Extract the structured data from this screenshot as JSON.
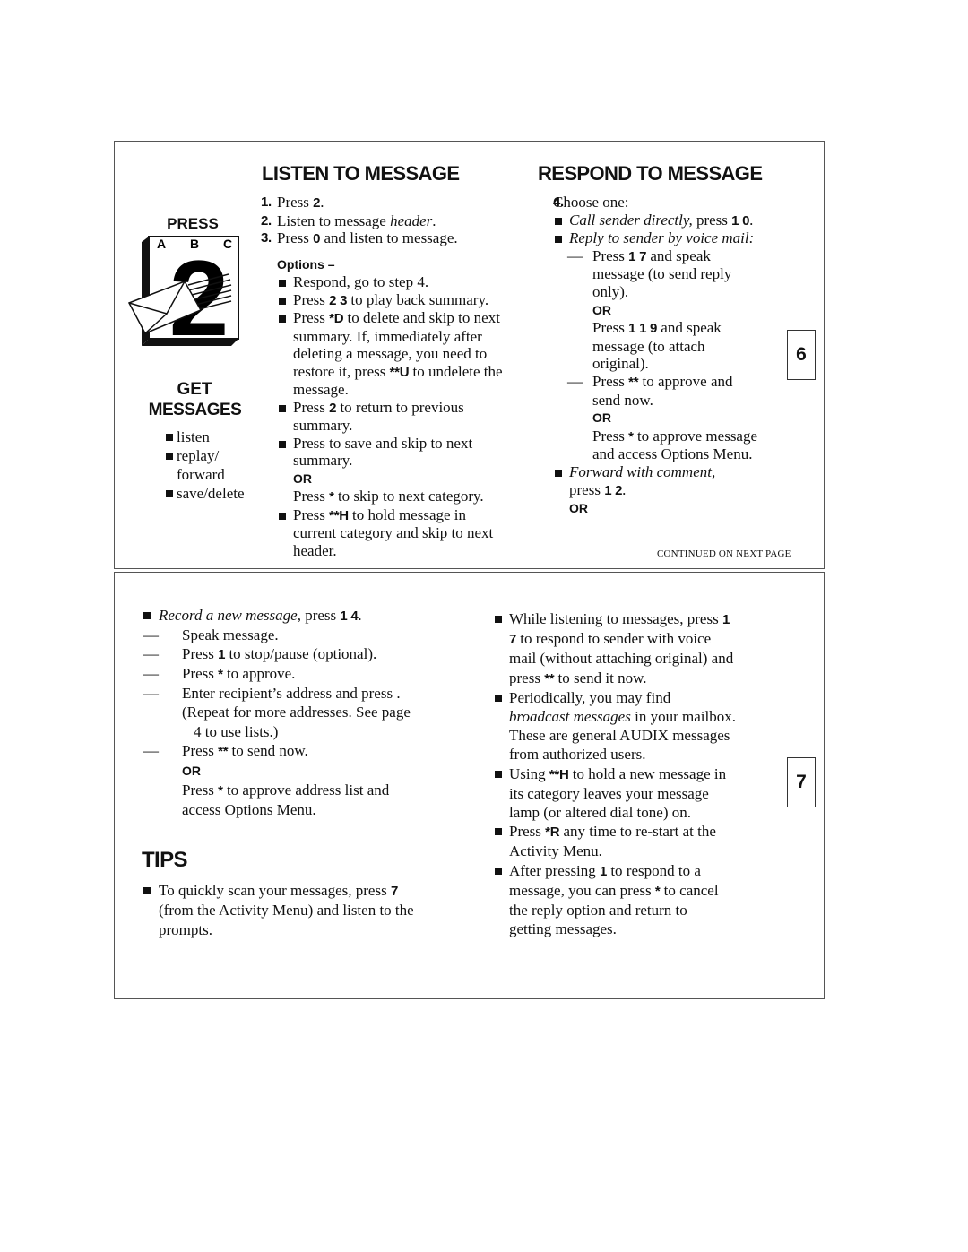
{
  "panel1": {
    "press_label": "PRESS",
    "keypad_letters": [
      "A",
      "B",
      "C"
    ],
    "keypad_digit": "2",
    "get_title": "GET",
    "messages_title": "MESSAGES",
    "get_list": [
      {
        "k": "bullet",
        "s": [
          [
            "r",
            "listen"
          ]
        ]
      },
      {
        "k": "bullet",
        "s": [
          [
            "r",
            "replay/"
          ]
        ]
      },
      {
        "k": "cont",
        "s": [
          [
            "r",
            "forward"
          ]
        ]
      },
      {
        "k": "bullet",
        "s": [
          [
            "r",
            "save/delete"
          ]
        ]
      }
    ],
    "listen_title": "LISTEN TO MESSAGE",
    "listen_lines": [
      {
        "k": "num",
        "n": "1.",
        "s": [
          [
            "r",
            "Press "
          ],
          [
            "b",
            "2"
          ],
          [
            "r",
            "."
          ]
        ]
      },
      {
        "k": "num",
        "n": "2.",
        "s": [
          [
            "r",
            "Listen to message "
          ],
          [
            "i",
            "header"
          ],
          [
            "r",
            "."
          ]
        ]
      },
      {
        "k": "num",
        "n": "3.",
        "s": [
          [
            "r",
            "Press "
          ],
          [
            "b",
            "0"
          ],
          [
            "r",
            " and listen to message."
          ]
        ]
      },
      {
        "k": "head",
        "s": [
          [
            "r",
            "Options –"
          ]
        ]
      },
      {
        "k": "bullet",
        "s": [
          [
            "r",
            "Respond, go to step 4."
          ]
        ]
      },
      {
        "k": "bullet",
        "s": [
          [
            "r",
            "Press "
          ],
          [
            "b",
            "2 3"
          ],
          [
            "r",
            " to play back summary."
          ]
        ]
      },
      {
        "k": "bullet",
        "s": [
          [
            "r",
            "Press "
          ],
          [
            "b",
            "*D"
          ],
          [
            "r",
            " to delete and skip to next"
          ]
        ]
      },
      {
        "k": "cont",
        "s": [
          [
            "r",
            "summary.  If, immediately after"
          ]
        ]
      },
      {
        "k": "cont",
        "s": [
          [
            "r",
            "deleting a message, you need to"
          ]
        ]
      },
      {
        "k": "cont",
        "s": [
          [
            "r",
            "restore it, press "
          ],
          [
            "b",
            "**U"
          ],
          [
            "r",
            " to undelete the"
          ]
        ]
      },
      {
        "k": "cont",
        "s": [
          [
            "r",
            "message."
          ]
        ]
      },
      {
        "k": "bullet",
        "s": [
          [
            "r",
            "Press "
          ],
          [
            "b",
            "2"
          ],
          [
            "r",
            " to return to previous"
          ]
        ]
      },
      {
        "k": "cont",
        "s": [
          [
            "r",
            "summary."
          ]
        ]
      },
      {
        "k": "bullet",
        "s": [
          [
            "r",
            "Press to save and skip to next"
          ]
        ]
      },
      {
        "k": "cont",
        "s": [
          [
            "r",
            "summary."
          ]
        ]
      },
      {
        "k": "cont",
        "s": [
          [
            "o",
            "OR"
          ]
        ]
      },
      {
        "k": "cont",
        "s": [
          [
            "r",
            "Press "
          ],
          [
            "b",
            "*"
          ],
          [
            "r",
            " to skip to next category."
          ]
        ]
      },
      {
        "k": "bullet",
        "s": [
          [
            "r",
            "Press "
          ],
          [
            "b",
            "**H"
          ],
          [
            "r",
            " to hold message in"
          ]
        ]
      },
      {
        "k": "cont",
        "s": [
          [
            "r",
            "current category and skip to next"
          ]
        ]
      },
      {
        "k": "cont",
        "s": [
          [
            "r",
            "header."
          ]
        ]
      }
    ],
    "respond_title": "RESPOND TO MESSAGE",
    "respond_lines": [
      {
        "k": "num",
        "n": "4.",
        "s": [
          [
            "r",
            "Choose one:"
          ]
        ]
      },
      {
        "k": "bullet",
        "s": [
          [
            "i",
            "Call sender directly,"
          ],
          [
            "r",
            " press "
          ],
          [
            "b",
            "1 0"
          ],
          [
            "r",
            "."
          ]
        ]
      },
      {
        "k": "bullet",
        "s": [
          [
            "i",
            "Reply to sender by voice mail:"
          ]
        ]
      },
      {
        "k": "dash",
        "s": [
          [
            "r",
            "Press "
          ],
          [
            "b",
            "1 7"
          ],
          [
            "r",
            " and speak"
          ]
        ]
      },
      {
        "k": "cont2",
        "s": [
          [
            "r",
            "message (to send reply"
          ]
        ]
      },
      {
        "k": "cont2",
        "s": [
          [
            "r",
            "only)."
          ]
        ]
      },
      {
        "k": "cont2",
        "s": [
          [
            "o",
            "OR"
          ]
        ]
      },
      {
        "k": "cont2",
        "s": [
          [
            "r",
            "Press "
          ],
          [
            "b",
            "1 1 9"
          ],
          [
            "r",
            " and speak"
          ]
        ]
      },
      {
        "k": "cont2",
        "s": [
          [
            "r",
            "message (to attach"
          ]
        ]
      },
      {
        "k": "cont2",
        "s": [
          [
            "r",
            "original)."
          ]
        ]
      },
      {
        "k": "dash",
        "s": [
          [
            "r",
            "Press "
          ],
          [
            "b",
            "**"
          ],
          [
            "r",
            " to approve and"
          ]
        ]
      },
      {
        "k": "cont2",
        "s": [
          [
            "r",
            "send now."
          ]
        ]
      },
      {
        "k": "cont2",
        "s": [
          [
            "o",
            "OR"
          ]
        ]
      },
      {
        "k": "cont2",
        "s": [
          [
            "r",
            "Press "
          ],
          [
            "b",
            "*"
          ],
          [
            "r",
            " to approve message"
          ]
        ]
      },
      {
        "k": "cont2",
        "s": [
          [
            "r",
            "and access Options Menu."
          ]
        ]
      },
      {
        "k": "bullet",
        "s": [
          [
            "i",
            "Forward with comment,"
          ]
        ]
      },
      {
        "k": "cont",
        "s": [
          [
            "r",
            "press "
          ],
          [
            "b",
            "1 2"
          ],
          [
            "r",
            "."
          ]
        ]
      },
      {
        "k": "cont",
        "s": [
          [
            "o",
            "OR"
          ]
        ]
      }
    ],
    "continued": "CONTINUED ON NEXT PAGE",
    "page_number": "6"
  },
  "panel2": {
    "left_lines": [
      {
        "k": "bullet",
        "s": [
          [
            "i",
            "Record a new message,"
          ],
          [
            "r",
            " press "
          ],
          [
            "b",
            "1 4"
          ],
          [
            "r",
            "."
          ]
        ]
      },
      {
        "k": "dash",
        "s": [
          [
            "r",
            "Speak message."
          ]
        ]
      },
      {
        "k": "dash",
        "s": [
          [
            "r",
            "Press "
          ],
          [
            "b",
            "1"
          ],
          [
            "r",
            " to stop/pause (optional)."
          ]
        ]
      },
      {
        "k": "dash",
        "s": [
          [
            "r",
            "Press "
          ],
          [
            "b",
            "*"
          ],
          [
            "r",
            " to approve."
          ]
        ]
      },
      {
        "k": "dash",
        "s": [
          [
            "r",
            "Enter recipient’s address and press ."
          ]
        ]
      },
      {
        "k": "cont2",
        "s": [
          [
            "r",
            "(Repeat for more addresses.  See page"
          ]
        ]
      },
      {
        "k": "cont3",
        "s": [
          [
            "r",
            "4 to use lists.)"
          ]
        ]
      },
      {
        "k": "dash",
        "s": [
          [
            "r",
            "Press "
          ],
          [
            "b",
            "**"
          ],
          [
            "r",
            " to send now."
          ]
        ]
      },
      {
        "k": "cont2",
        "s": [
          [
            "o",
            "OR"
          ]
        ]
      },
      {
        "k": "cont2",
        "s": [
          [
            "r",
            "Press "
          ],
          [
            "b",
            "*"
          ],
          [
            "r",
            " to approve address list and"
          ]
        ]
      },
      {
        "k": "cont2",
        "s": [
          [
            "r",
            "access Options Menu."
          ]
        ]
      }
    ],
    "tips_title": "TIPS",
    "tips_lines": [
      {
        "k": "bullet",
        "s": [
          [
            "r",
            "To quickly scan your messages, press "
          ],
          [
            "b",
            "7"
          ]
        ]
      },
      {
        "k": "cont",
        "s": [
          [
            "r",
            "(from the Activity Menu) and listen to the"
          ]
        ]
      },
      {
        "k": "cont",
        "s": [
          [
            "r",
            "prompts."
          ]
        ]
      }
    ],
    "right_lines": [
      {
        "k": "bullet",
        "s": [
          [
            "r",
            "While listening to messages, press "
          ],
          [
            "b",
            "1"
          ]
        ]
      },
      {
        "k": "cont",
        "s": [
          [
            "b",
            "7"
          ],
          [
            "r",
            " to respond to sender with voice"
          ]
        ]
      },
      {
        "k": "cont",
        "s": [
          [
            "r",
            "mail (without attaching original) and"
          ]
        ]
      },
      {
        "k": "cont",
        "s": [
          [
            "r",
            "press "
          ],
          [
            "b",
            "**"
          ],
          [
            "r",
            " to send it now."
          ]
        ]
      },
      {
        "k": "bullet",
        "s": [
          [
            "r",
            "Periodically, you may find"
          ]
        ]
      },
      {
        "k": "cont",
        "s": [
          [
            "i",
            "broadcast messages"
          ],
          [
            "r",
            "  in your mailbox."
          ]
        ]
      },
      {
        "k": "cont",
        "s": [
          [
            "r",
            "These are general AUDIX messages"
          ]
        ]
      },
      {
        "k": "cont",
        "s": [
          [
            "r",
            "from authorized users."
          ]
        ]
      },
      {
        "k": "bullet",
        "s": [
          [
            "r",
            "Using "
          ],
          [
            "b",
            "**H"
          ],
          [
            "r",
            " to hold a new message in"
          ]
        ]
      },
      {
        "k": "cont",
        "s": [
          [
            "r",
            "its category leaves your message"
          ]
        ]
      },
      {
        "k": "cont",
        "s": [
          [
            "r",
            "lamp (or altered dial tone) on."
          ]
        ]
      },
      {
        "k": "bullet",
        "s": [
          [
            "r",
            "Press "
          ],
          [
            "b",
            "*R"
          ],
          [
            "r",
            " any time to re-start at the"
          ]
        ]
      },
      {
        "k": "cont",
        "s": [
          [
            "r",
            "Activity Menu."
          ]
        ]
      },
      {
        "k": "bullet",
        "s": [
          [
            "r",
            "After pressing "
          ],
          [
            "b",
            "1"
          ],
          [
            "r",
            " to respond to a"
          ]
        ]
      },
      {
        "k": "cont",
        "s": [
          [
            "r",
            "message, you can press "
          ],
          [
            "b",
            "*"
          ],
          [
            "r",
            " to cancel"
          ]
        ]
      },
      {
        "k": "cont",
        "s": [
          [
            "r",
            "the reply option and return to"
          ]
        ]
      },
      {
        "k": "cont",
        "s": [
          [
            "r",
            "getting messages."
          ]
        ]
      }
    ],
    "page_number": "7"
  }
}
